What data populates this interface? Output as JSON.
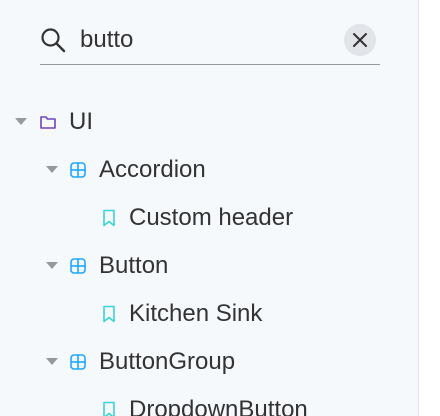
{
  "search": {
    "value": "butto",
    "icon": "search-icon",
    "clear_icon": "close-icon"
  },
  "colors": {
    "folder": "#6f42c1",
    "component": "#1ea7fd",
    "story": "#37d5d3",
    "text": "#333333"
  },
  "tree": {
    "root": {
      "label": "UI",
      "icon": "folder-icon",
      "expanded": true
    },
    "accordion": {
      "label": "Accordion",
      "icon": "component-icon",
      "expanded": true
    },
    "custom_header": {
      "label": "Custom header",
      "icon": "bookmark-icon"
    },
    "button": {
      "label": "Button",
      "icon": "component-icon",
      "expanded": true
    },
    "kitchen_sink": {
      "label": "Kitchen Sink",
      "icon": "bookmark-icon"
    },
    "button_group": {
      "label": "ButtonGroup",
      "icon": "component-icon",
      "expanded": true
    },
    "dropdown_button": {
      "label": "DropdownButton",
      "icon": "bookmark-icon"
    }
  }
}
